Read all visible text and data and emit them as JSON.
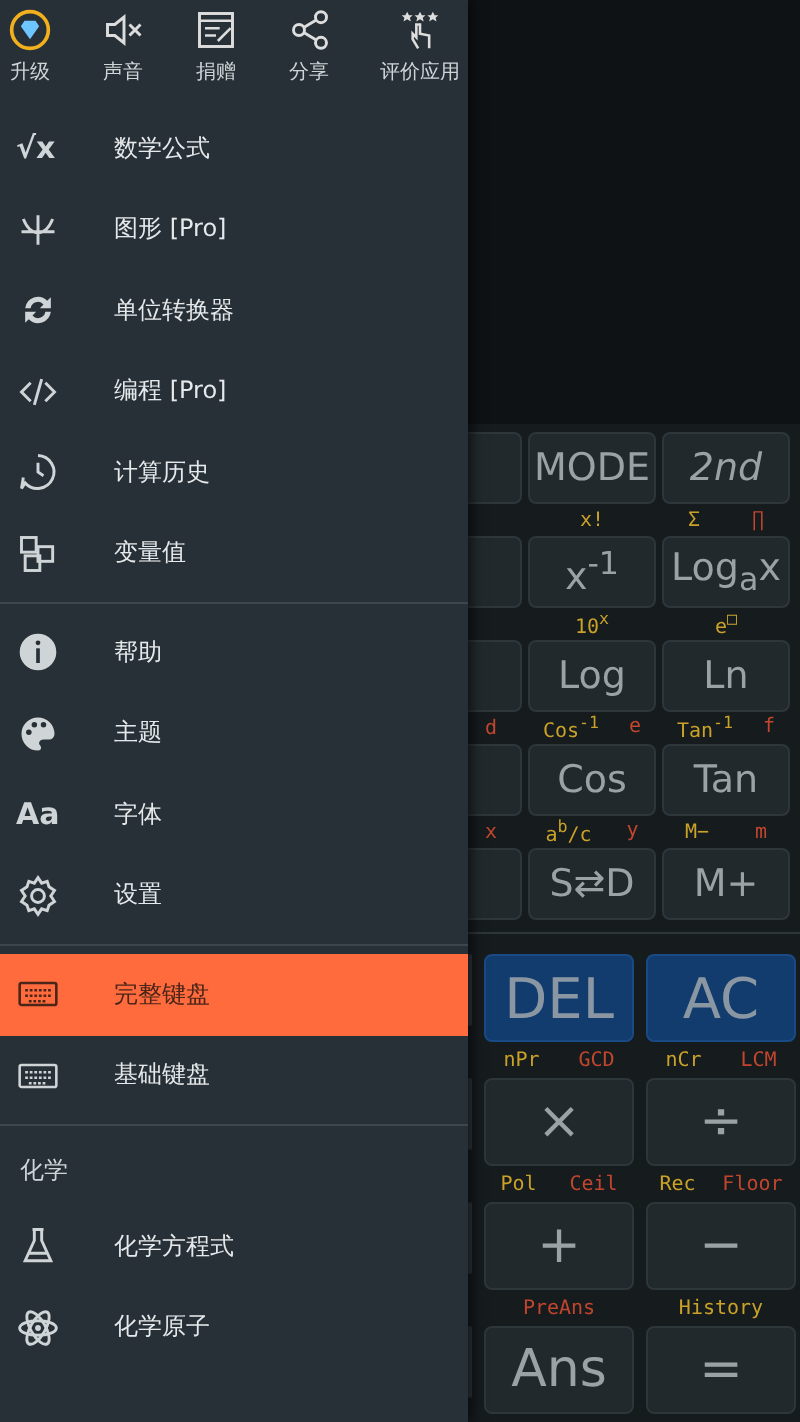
{
  "drawer": {
    "top_actions": [
      {
        "label": "升级"
      },
      {
        "label": "声音"
      },
      {
        "label": "捐赠"
      },
      {
        "label": "分享"
      },
      {
        "label": "评价应用"
      }
    ],
    "sections": [
      {
        "items": [
          {
            "glyph": "√x",
            "label": "数学公式",
            "selected": false
          },
          {
            "label": "图形 [Pro]",
            "selected": false
          },
          {
            "label": "单位转换器",
            "selected": false
          },
          {
            "label": "编程 [Pro]",
            "selected": false
          },
          {
            "label": "计算历史",
            "selected": false
          },
          {
            "label": "变量值",
            "selected": false
          }
        ]
      },
      {
        "items": [
          {
            "label": "帮助",
            "selected": false
          },
          {
            "label": "主题",
            "selected": false
          },
          {
            "glyph": "Aa",
            "label": "字体",
            "selected": false
          },
          {
            "label": "设置",
            "selected": false
          }
        ]
      },
      {
        "items": [
          {
            "label": "完整键盘",
            "selected": true
          },
          {
            "label": "基础键盘",
            "selected": false
          }
        ]
      },
      {
        "header": "化学",
        "items": [
          {
            "label": "化学方程式",
            "selected": false
          },
          {
            "label": "化学原子",
            "selected": false
          }
        ]
      }
    ]
  },
  "calculator": {
    "upper_rows": [
      {
        "keys": [
          {
            "kind": "stub"
          },
          {
            "kind": "plain",
            "label": "MODE"
          },
          {
            "kind": "italic",
            "label": "2nd"
          }
        ]
      },
      {
        "keys": [
          {
            "kind": "stub"
          },
          {
            "kind": "plain",
            "label": "x$^{-1}$",
            "shift": "x!"
          },
          {
            "kind": "plain",
            "label": "Log$_{a}$x",
            "shift": "Σ",
            "alpha": "∏"
          }
        ]
      },
      {
        "keys": [
          {
            "kind": "stub"
          },
          {
            "kind": "plain",
            "label": "Log",
            "shift": "10$^{x}$"
          },
          {
            "kind": "plain",
            "label": "Ln",
            "shift": "e$^{□}$"
          }
        ]
      },
      {
        "keys": [
          {
            "kind": "stub",
            "alpha": "d"
          },
          {
            "kind": "plain",
            "label": "Cos",
            "shift": "Cos$^{-1}$",
            "alpha": "e"
          },
          {
            "kind": "plain",
            "label": "Tan",
            "shift": "Tan$^{-1}$",
            "alpha": "f"
          }
        ]
      },
      {
        "keys": [
          {
            "kind": "stub",
            "alpha": "x"
          },
          {
            "kind": "plain",
            "label": "S⇄D",
            "shift": "a$^{b}$/c",
            "alpha": "y"
          },
          {
            "kind": "plain",
            "label": "M+",
            "shift": "M−",
            "alpha": "m"
          }
        ]
      }
    ],
    "lower_rows": [
      {
        "keys": [
          {
            "kind": "stub"
          },
          {
            "kind": "accent",
            "label": "DEL"
          },
          {
            "kind": "accent",
            "label": "AC"
          }
        ]
      },
      {
        "keys": [
          {
            "kind": "stub"
          },
          {
            "kind": "plain",
            "label": "×",
            "shift": "nPr",
            "alpha": "GCD"
          },
          {
            "kind": "plain",
            "label": "÷",
            "shift": "nCr",
            "alpha": "LCM"
          }
        ]
      },
      {
        "keys": [
          {
            "kind": "stub"
          },
          {
            "kind": "plain",
            "label": "+",
            "shift": "Pol",
            "alpha": "Ceil"
          },
          {
            "kind": "plain",
            "label": "−",
            "shift": "Rec",
            "alpha": "Floor"
          }
        ]
      },
      {
        "keys": [
          {
            "kind": "stub"
          },
          {
            "kind": "plain",
            "label": "Ans",
            "alpha": "PreAns"
          },
          {
            "kind": "plain",
            "label": "=",
            "shift": "History"
          }
        ]
      }
    ]
  }
}
